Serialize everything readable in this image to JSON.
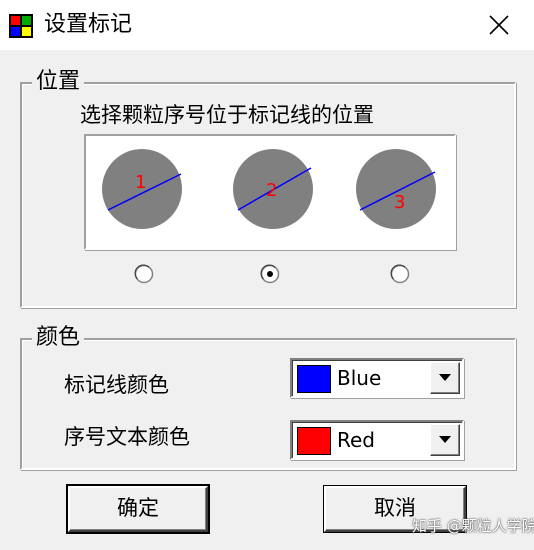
{
  "window": {
    "title": "设置标记",
    "icon": "app-window-icon",
    "close_icon": "close-icon"
  },
  "position_group": {
    "legend": "位置",
    "instruction": "选择颗粒序号位于标记线的位置",
    "particles": [
      {
        "number": "1"
      },
      {
        "number": "2"
      },
      {
        "number": "3"
      }
    ],
    "selected_option": 2,
    "particle_color": "#808080",
    "line_color": "#0000ff",
    "number_color": "#ff0000"
  },
  "color_group": {
    "legend": "颜色",
    "marker_line_label": "标记线颜色",
    "marker_line_value": "Blue",
    "marker_line_swatch": "#0000ff",
    "number_text_label": "序号文本颜色",
    "number_text_value": "Red",
    "number_text_swatch": "#ff0000"
  },
  "buttons": {
    "ok": "确定",
    "cancel": "取消"
  },
  "watermark": "知乎 @颗粒人学院"
}
